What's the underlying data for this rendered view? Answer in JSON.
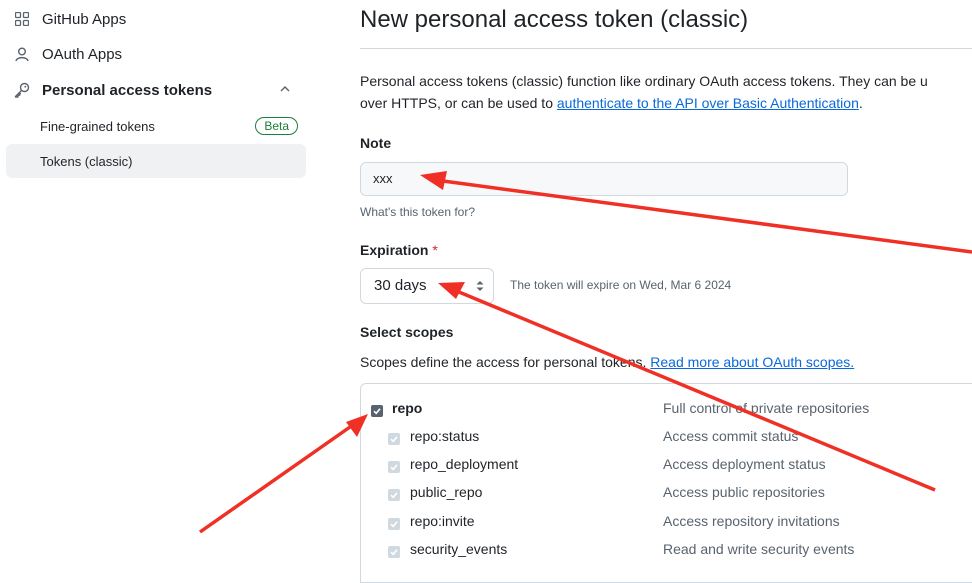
{
  "sidebar": {
    "items": [
      {
        "label": "GitHub Apps",
        "icon": "apps-grid-icon"
      },
      {
        "label": "OAuth Apps",
        "icon": "person-icon"
      },
      {
        "label": "Personal access tokens",
        "icon": "key-icon"
      }
    ],
    "sub_items": [
      {
        "label": "Fine-grained tokens",
        "badge": "Beta"
      },
      {
        "label": "Tokens (classic)"
      }
    ]
  },
  "page": {
    "title": "New personal access token (classic)",
    "description_line1": "Personal access tokens (classic) function like ordinary OAuth access tokens. They can be u",
    "description_line2_prefix": "over HTTPS, or can be used to ",
    "description_link": "authenticate to the API over Basic Authentication",
    "description_line2_suffix": "."
  },
  "note": {
    "label": "Note",
    "value": "xxx",
    "hint": "What's this token for?"
  },
  "expiration": {
    "label": "Expiration",
    "required_mark": "*",
    "selected": "30 days",
    "expire_text": "The token will expire on Wed, Mar 6 2024"
  },
  "scopes": {
    "label": "Select scopes",
    "description_prefix": "Scopes define the access for personal tokens. ",
    "description_link": "Read more about OAuth scopes.",
    "rows": [
      {
        "name": "repo",
        "text": "Full control of private repositories",
        "checked": true,
        "parent": true
      },
      {
        "name": "repo:status",
        "text": "Access commit status",
        "checked": true,
        "parent": false
      },
      {
        "name": "repo_deployment",
        "text": "Access deployment status",
        "checked": true,
        "parent": false
      },
      {
        "name": "public_repo",
        "text": "Access public repositories",
        "checked": true,
        "parent": false
      },
      {
        "name": "repo:invite",
        "text": "Access repository invitations",
        "checked": true,
        "parent": false
      },
      {
        "name": "security_events",
        "text": "Read and write security events",
        "checked": true,
        "parent": false
      }
    ]
  },
  "colors": {
    "accent": "#0969da",
    "annotation_arrow": "#f03024",
    "beta_green": "#1a7f37"
  }
}
